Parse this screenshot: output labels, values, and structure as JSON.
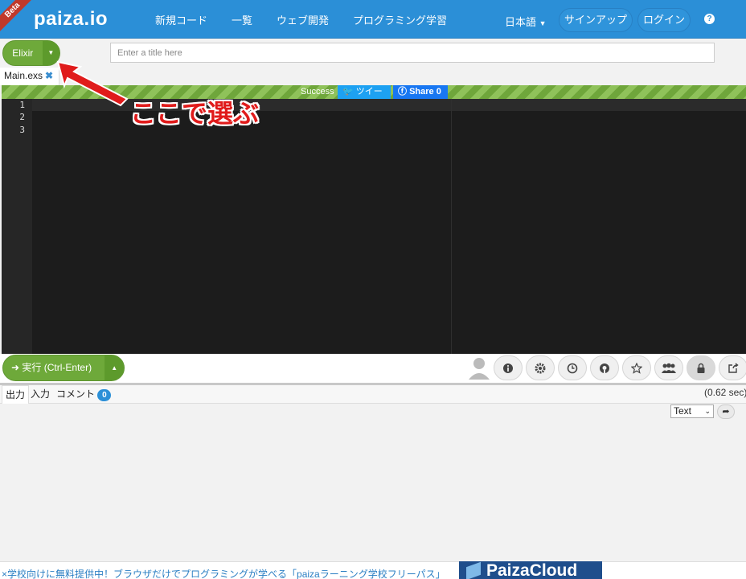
{
  "header": {
    "beta": "Beta",
    "logo": "paiza.io",
    "nav": [
      "新規コード",
      "一覧",
      "ウェブ開発",
      "プログラミング学習"
    ],
    "language": "日本語",
    "signup": "サインアップ",
    "login": "ログイン",
    "help": "?"
  },
  "editor_toolbar": {
    "language_selected": "Elixir",
    "title_placeholder": "Enter a title here"
  },
  "file_tab": {
    "name": "Main.exs"
  },
  "status": {
    "text": "Success",
    "tweet": "ツイート",
    "share": "Share 0"
  },
  "editor": {
    "line_numbers": [
      "1",
      "2",
      "3"
    ]
  },
  "annotation": {
    "text": "ここで選ぶ",
    "color": "#e01b1b"
  },
  "run": {
    "label": "実行 (Ctrl-Enter)"
  },
  "toolbar_icons": [
    "info-icon",
    "gear-icon",
    "clock-icon",
    "github-icon",
    "star-icon",
    "group-icon",
    "lock-icon",
    "share-icon"
  ],
  "output": {
    "tabs": {
      "output": "出力",
      "input": "入力",
      "comment": "コメント"
    },
    "comment_count": "0",
    "time": "(0.62 sec)",
    "format": "Text"
  },
  "banner": {
    "text": "学校向けに無料提供中！ブラウザだけでプログラミングが学べる「paizaラーニング学校フリーパス」",
    "cloud": "PaizaCloud"
  },
  "colors": {
    "header": "#2b8fd7",
    "green": "#6ea93a",
    "editor_bg": "#1c1c1c"
  }
}
